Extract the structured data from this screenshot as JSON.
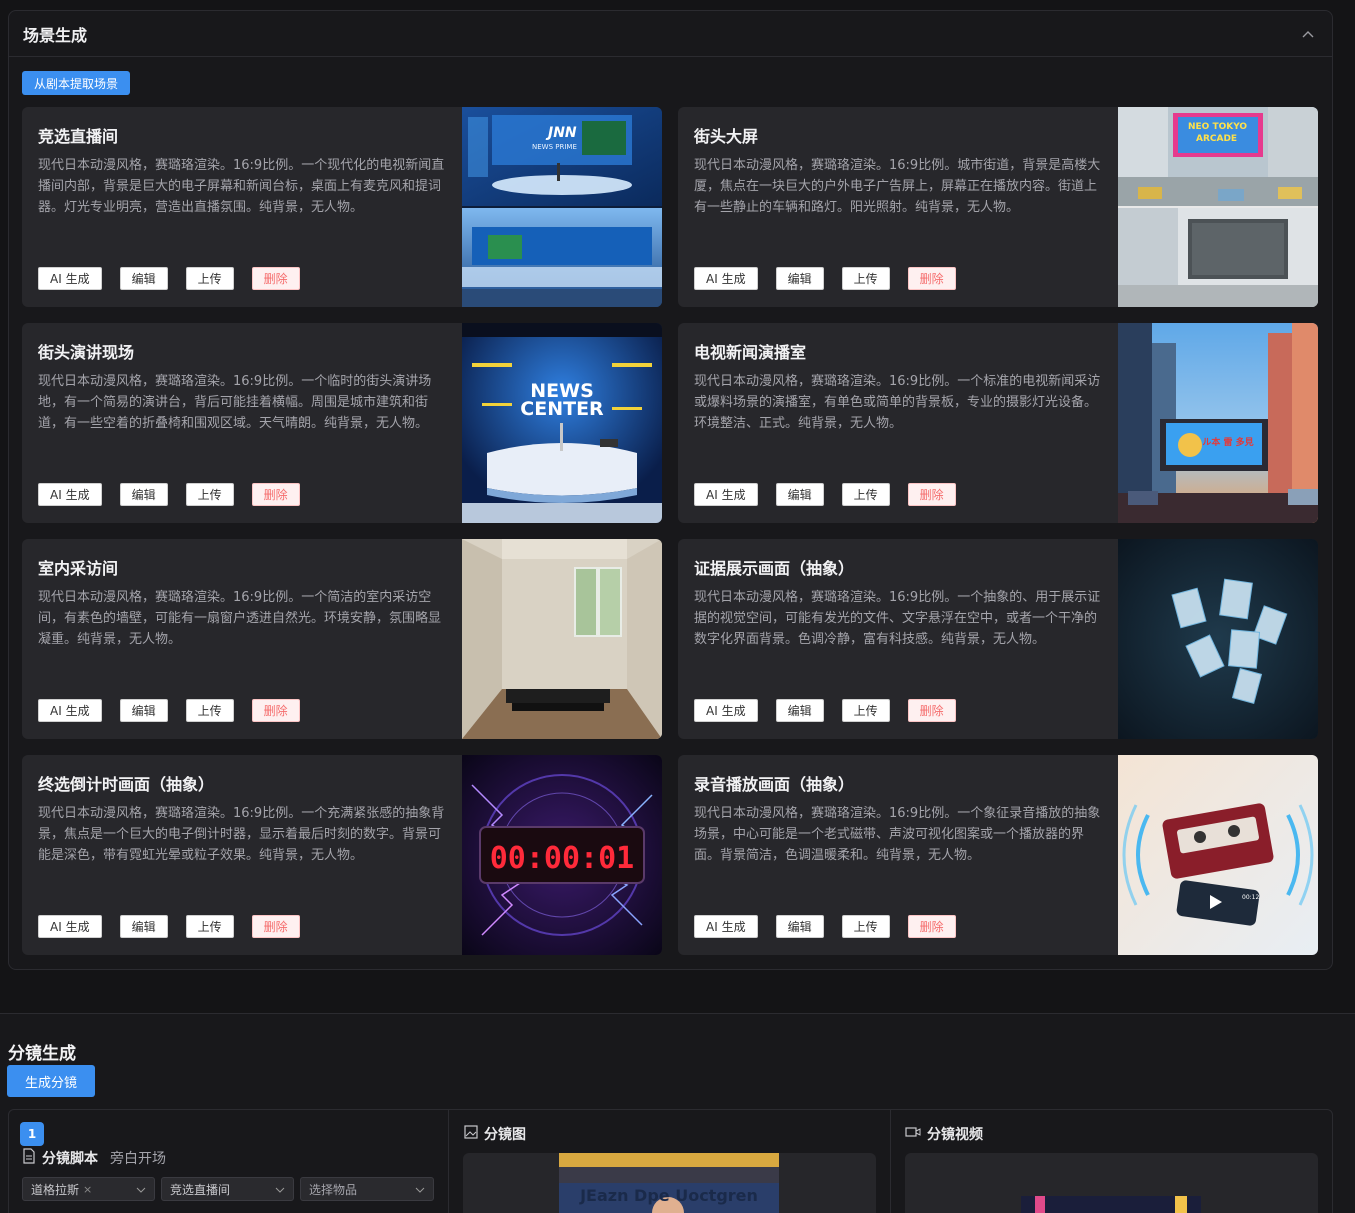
{
  "scene_section": {
    "title": "场景生成",
    "extract_button": "从剧本提取场景"
  },
  "buttons": {
    "ai": "AI 生成",
    "edit": "编辑",
    "upload": "上传",
    "delete": "删除"
  },
  "cards": [
    {
      "title": "竞选直播间",
      "desc": "现代日本动漫风格，赛璐珞渲染。16:9比例。一个现代化的电视新闻直播间内部，背景是巨大的电子屏幕和新闻台标，桌面上有麦克风和提词器。灯光专业明亮，营造出直播氛围。纯背景，无人物。",
      "image_text_1": "JNN",
      "image_text_2": "NEWS PRIME"
    },
    {
      "title": "街头大屏",
      "desc": "现代日本动漫风格，赛璐珞渲染。16:9比例。城市街道，背景是高楼大厦，焦点在一块巨大的户外电子广告屏上，屏幕正在播放内容。街道上有一些静止的车辆和路灯。阳光照射。纯背景，无人物。",
      "image_text_1": "NEO TOKYO",
      "image_text_2": "ARCADE"
    },
    {
      "title": "街头演讲现场",
      "desc": "现代日本动漫风格，赛璐珞渲染。16:9比例。一个临时的街头演讲场地，有一个简易的演讲台，背后可能挂着横幅。周围是城市建筑和街道，有一些空着的折叠椅和围观区域。天气晴朗。纯背景，无人物。",
      "image_text_1": "NEWS",
      "image_text_2": "CENTER"
    },
    {
      "title": "电视新闻演播室",
      "desc": "现代日本动漫风格，赛璐珞渲染。16:9比例。一个标准的电视新闻采访或爆料场景的演播室，有单色或简单的背景板，专业的摄影灯光设备。环境整洁、正式。纯背景，无人物。",
      "image_text_1": "ル本 雷 多見"
    },
    {
      "title": "室内采访间",
      "desc": "现代日本动漫风格，赛璐珞渲染。16:9比例。一个简洁的室内采访空间，有素色的墙壁，可能有一扇窗户透进自然光。环境安静，氛围略显凝重。纯背景，无人物。"
    },
    {
      "title": "证据展示画面（抽象）",
      "desc": "现代日本动漫风格，赛璐珞渲染。16:9比例。一个抽象的、用于展示证据的视觉空间，可能有发光的文件、文字悬浮在空中，或者一个干净的数字化界面背景。色调冷静，富有科技感。纯背景，无人物。"
    },
    {
      "title": "终选倒计时画面（抽象）",
      "desc": "现代日本动漫风格，赛璐珞渲染。16:9比例。一个充满紧张感的抽象背景，焦点是一个巨大的电子倒计时器，显示着最后时刻的数字。背景可能是深色，带有霓虹光晕或粒子效果。纯背景，无人物。",
      "image_text_1": "00:00:01"
    },
    {
      "title": "录音播放画面（抽象）",
      "desc": "现代日本动漫风格，赛璐珞渲染。16:9比例。一个象征录音播放的抽象场景，中心可能是一个老式磁带、声波可视化图案或一个播放器的界面。背景简洁，色调温暖柔和。纯背景，无人物。",
      "image_text_1": "00:12"
    }
  ],
  "storyboard_section": {
    "title": "分镜生成",
    "generate_button": "生成分镜",
    "item_number": "1",
    "script_label": "分镜脚本",
    "script_subtitle": "旁白开场",
    "character_select": "道格拉斯",
    "scene_select": "竞选直播间",
    "prop_select_placeholder": "选择物品",
    "image_label": "分镜图",
    "video_label": "分镜视频",
    "frame_image_text": "JEazn Dpe Uoctgren"
  },
  "colors": {
    "accent": "#3b8ff0",
    "danger": "#f56c6c",
    "card_bg": "#27272b"
  }
}
